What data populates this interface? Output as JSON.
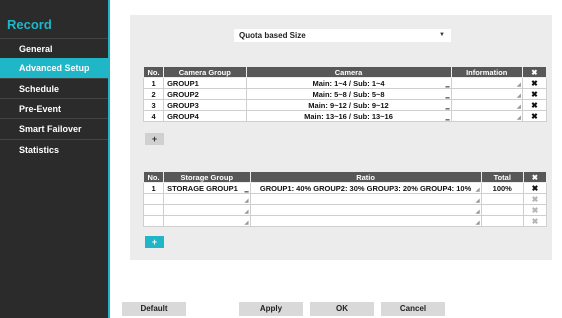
{
  "sidebar": {
    "title": "Record",
    "items": [
      {
        "label": "General"
      },
      {
        "label": "Advanced Setup"
      },
      {
        "label": "Schedule"
      },
      {
        "label": "Pre-Event"
      },
      {
        "label": "Smart Failover"
      },
      {
        "label": "Statistics"
      }
    ],
    "active_index": 1
  },
  "quota_select": {
    "value": "Quota based Size",
    "icon": "chevron-down-icon"
  },
  "camera_table": {
    "headers": [
      "No.",
      "Camera Group",
      "Camera",
      "Information",
      "✖"
    ],
    "rows": [
      {
        "no": "1",
        "group": "GROUP1",
        "camera": "Main: 1~4 / Sub: 1~4",
        "info": ""
      },
      {
        "no": "2",
        "group": "GROUP2",
        "camera": "Main: 5~8 / Sub: 5~8",
        "info": ""
      },
      {
        "no": "3",
        "group": "GROUP3",
        "camera": "Main: 9~12 / Sub: 9~12",
        "info": ""
      },
      {
        "no": "4",
        "group": "GROUP4",
        "camera": "Main: 13~16 / Sub: 13~16",
        "info": ""
      }
    ],
    "add_label": "+"
  },
  "storage_table": {
    "headers": [
      "No.",
      "Storage Group",
      "Ratio",
      "Total",
      "✖"
    ],
    "rows": [
      {
        "no": "1",
        "group": "STORAGE GROUP1",
        "ratio": "GROUP1: 40%  GROUP2: 30%  GROUP3: 20%  GROUP4: 10%",
        "total": "100%"
      },
      {
        "no": "",
        "group": "",
        "ratio": "",
        "total": ""
      },
      {
        "no": "",
        "group": "",
        "ratio": "",
        "total": ""
      },
      {
        "no": "",
        "group": "",
        "ratio": "",
        "total": ""
      }
    ],
    "add_label": "+"
  },
  "delete_icon": "✖",
  "buttons": {
    "default": "Default",
    "apply": "Apply",
    "ok": "OK",
    "cancel": "Cancel"
  },
  "colors": {
    "accent": "#1fb6c8",
    "sidebar_bg": "#2b2b2b",
    "header_bg": "#585858"
  }
}
